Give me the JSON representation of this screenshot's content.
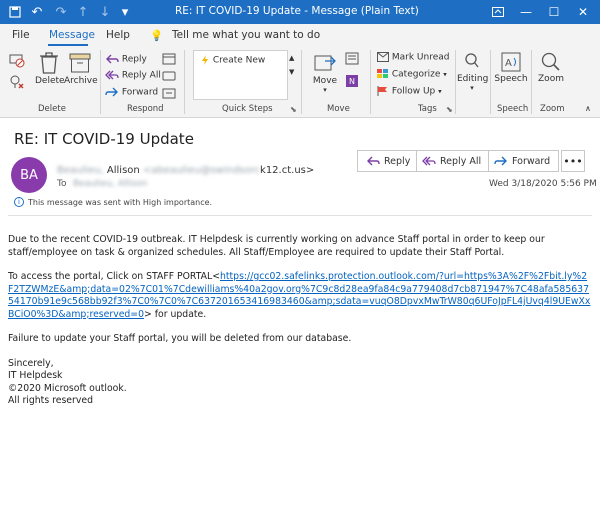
{
  "window": {
    "title": "RE: IT COVID-19 Update  -  Message (Plain Text)",
    "controls": [
      "restore-icon",
      "minimize-icon",
      "maximize-icon",
      "close-icon"
    ]
  },
  "tabs": [
    {
      "label": "File"
    },
    {
      "label": "Message"
    },
    {
      "label": "Help"
    }
  ],
  "tell_me": "Tell me what you want to do",
  "ribbon": {
    "delete_group": {
      "label": "Delete",
      "delete": "Delete",
      "archive": "Archive"
    },
    "respond_group": {
      "label": "Respond",
      "reply": "Reply",
      "reply_all": "Reply All",
      "forward": "Forward"
    },
    "quick_steps": {
      "label": "Quick Steps",
      "create_new": "Create New"
    },
    "move_group": {
      "label": "Move",
      "move": "Move"
    },
    "tags_group": {
      "label": "Tags",
      "mark_unread": "Mark Unread",
      "categorize": "Categorize",
      "follow_up": "Follow Up"
    },
    "editing": {
      "label": "Editing"
    },
    "speech": {
      "label": "Speech"
    },
    "zoom": {
      "label": "Zoom"
    }
  },
  "message": {
    "subject": "RE: IT COVID-19 Update",
    "actions": {
      "reply": "Reply",
      "reply_all": "Reply All",
      "forward": "Forward",
      "more": "•••"
    },
    "avatar_initials": "BA",
    "avatar_color": "#8a3bab",
    "from_hidden": "Beaulieu,",
    "from_name": "Allison",
    "from_email_hidden": "<abeaulieu@swindsorc",
    "from_email_visible": "k12.ct.us>",
    "to_label": "To",
    "to_hidden": "Beaulieu, Allison",
    "date": "Wed 3/18/2020 5:56 PM",
    "importance": "This message was sent with High importance."
  },
  "body": {
    "p1": " Due to the recent COVID-19 outbreak. IT Helpdesk is currently working on advance Staff portal in order to keep our staff/employee on task & organized schedules. All Staff/Employee are required to update their Staff Portal.",
    "p2_prefix": "To access the portal, Click on STAFF PORTAL<",
    "p2_link": "https://gcc02.safelinks.protection.outlook.com/?url=https%3A%2F%2Fbit.ly%2F2TZWMzE&amp;data=02%7C01%7Cdewilliams%40a2gov.org%7C9c8d28ea9fa84c9a779408d7cb871947%7C48afa58563754170b91e9c568bb92f3%7C0%7C0%7C637201653416983460&amp;sdata=vuqO8DpvxMwTrW80q6UFoJpFL4jUvq4l9UEwXxBCiO0%3D&amp;reserved=0",
    "p2_suffix": "> for update.",
    "p3": "Failure to update your Staff portal, you will be deleted from our database.",
    "sig1": "Sincerely,",
    "sig2": "IT Helpdesk",
    "sig3": "©2020 Microsoft outlook.",
    "sig4": "All rights reserved"
  },
  "colors": {
    "accent": "#1e6fc4",
    "link": "#0563c1",
    "avatar": "#8a3bab"
  }
}
